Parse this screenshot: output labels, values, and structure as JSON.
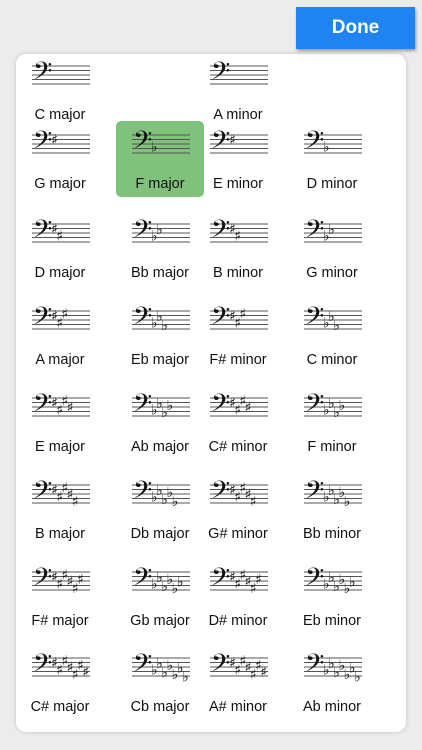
{
  "done_label": "Done",
  "clef_glyph": "𝄢",
  "selected_key": "F major",
  "keys": [
    {
      "label": "C major",
      "sharps": 0,
      "flats": 0
    },
    {
      "label": "A minor",
      "sharps": 0,
      "flats": 0
    },
    {
      "label": "G major",
      "sharps": 1,
      "flats": 0
    },
    {
      "label": "F major",
      "sharps": 0,
      "flats": 1
    },
    {
      "label": "E minor",
      "sharps": 1,
      "flats": 0
    },
    {
      "label": "D minor",
      "sharps": 0,
      "flats": 1
    },
    {
      "label": "D major",
      "sharps": 2,
      "flats": 0
    },
    {
      "label": "Bb major",
      "sharps": 0,
      "flats": 2
    },
    {
      "label": "B minor",
      "sharps": 2,
      "flats": 0
    },
    {
      "label": "G minor",
      "sharps": 0,
      "flats": 2
    },
    {
      "label": "A major",
      "sharps": 3,
      "flats": 0
    },
    {
      "label": "Eb major",
      "sharps": 0,
      "flats": 3
    },
    {
      "label": "F# minor",
      "sharps": 3,
      "flats": 0
    },
    {
      "label": "C minor",
      "sharps": 0,
      "flats": 3
    },
    {
      "label": "E major",
      "sharps": 4,
      "flats": 0
    },
    {
      "label": "Ab major",
      "sharps": 0,
      "flats": 4
    },
    {
      "label": "C# minor",
      "sharps": 4,
      "flats": 0
    },
    {
      "label": "F minor",
      "sharps": 0,
      "flats": 4
    },
    {
      "label": "B major",
      "sharps": 5,
      "flats": 0
    },
    {
      "label": "Db major",
      "sharps": 0,
      "flats": 5
    },
    {
      "label": "G# minor",
      "sharps": 5,
      "flats": 0
    },
    {
      "label": "Bb minor",
      "sharps": 0,
      "flats": 5
    },
    {
      "label": "F# major",
      "sharps": 6,
      "flats": 0
    },
    {
      "label": "Gb major",
      "sharps": 0,
      "flats": 6
    },
    {
      "label": "D# minor",
      "sharps": 6,
      "flats": 0
    },
    {
      "label": "Eb minor",
      "sharps": 0,
      "flats": 6
    },
    {
      "label": "C# major",
      "sharps": 7,
      "flats": 0
    },
    {
      "label": "Cb major",
      "sharps": 0,
      "flats": 7
    },
    {
      "label": "A# minor",
      "sharps": 7,
      "flats": 0
    },
    {
      "label": "Ab minor",
      "sharps": 0,
      "flats": 7
    }
  ]
}
